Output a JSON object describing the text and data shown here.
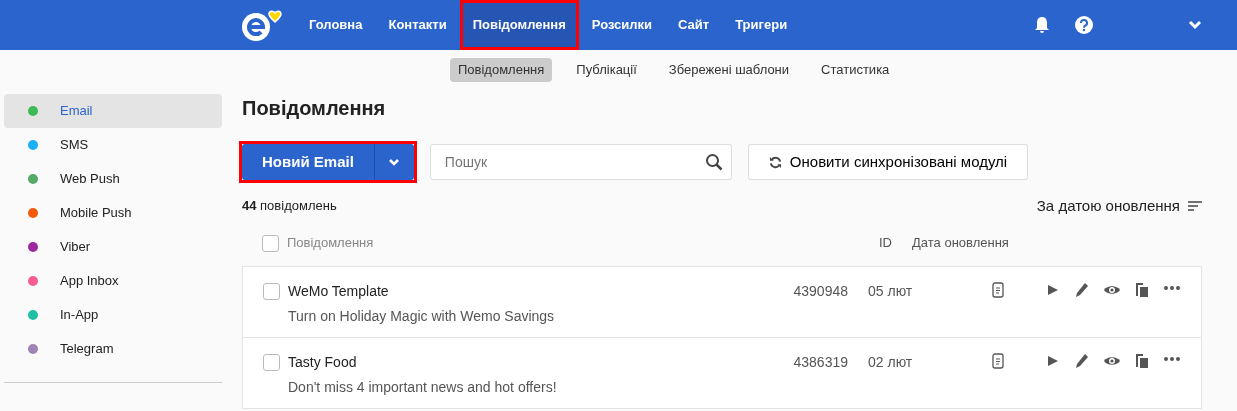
{
  "nav": [
    {
      "label": "Головна",
      "selected": false,
      "highlighted": false
    },
    {
      "label": "Контакти",
      "selected": false,
      "highlighted": false
    },
    {
      "label": "Повідомлення",
      "selected": true,
      "highlighted": true
    },
    {
      "label": "Розсилки",
      "selected": false,
      "highlighted": false
    },
    {
      "label": "Сайт",
      "selected": false,
      "highlighted": false
    },
    {
      "label": "Тригери",
      "selected": false,
      "highlighted": false
    }
  ],
  "subnav": [
    {
      "label": "Повідомлення",
      "selected": true
    },
    {
      "label": "Публікації",
      "selected": false
    },
    {
      "label": "Збережені шаблони",
      "selected": false
    },
    {
      "label": "Статистика",
      "selected": false
    }
  ],
  "sidebar": {
    "items": [
      {
        "label": "Email",
        "color": "#3cba54",
        "selected": true
      },
      {
        "label": "SMS",
        "color": "#1ab0f5",
        "selected": false
      },
      {
        "label": "Web Push",
        "color": "#55aa66",
        "selected": false
      },
      {
        "label": "Mobile Push",
        "color": "#f55a0a",
        "selected": false
      },
      {
        "label": "Viber",
        "color": "#9b2a9f",
        "selected": false
      },
      {
        "label": "App Inbox",
        "color": "#f75c92",
        "selected": false
      },
      {
        "label": "In-App",
        "color": "#20c0a5",
        "selected": false
      },
      {
        "label": "Telegram",
        "color": "#a184b5",
        "selected": false
      }
    ]
  },
  "page_title": "Повідомлення",
  "new_button": {
    "label": "Новий Email",
    "highlighted": true
  },
  "search": {
    "placeholder": "Пошук"
  },
  "sync_button": "Оновити синхронізовані модулі",
  "count": "**44** повідомлень",
  "sort": "За датою оновлення",
  "table": {
    "select_all_checked": false,
    "columns": [
      "Повідомлення",
      "ID",
      "Дата оновлення"
    ],
    "rows": [
      {
        "name": "WeMo Template",
        "subject": "Turn on Holiday Magic with Wemo Savings",
        "id": "4390948",
        "date": "05 лют",
        "checked": false
      },
      {
        "name": "Tasty Food",
        "subject": "Don't miss 4 important news and hot offers!",
        "id": "4386319",
        "date": "02 лют",
        "checked": false
      }
    ]
  }
}
